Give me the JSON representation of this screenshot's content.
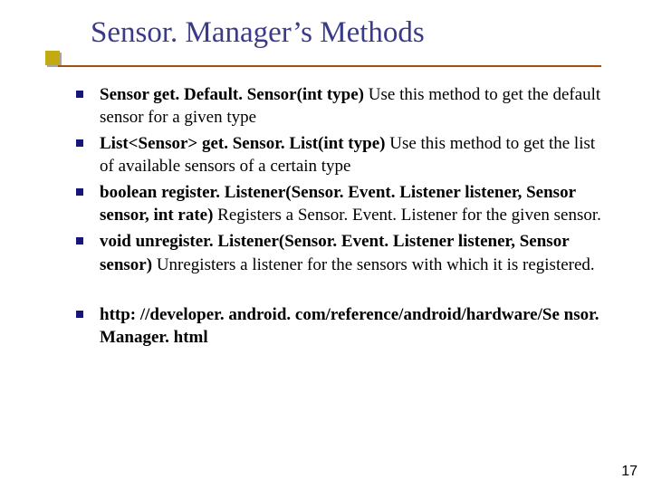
{
  "title": "Sensor. Manager’s Methods",
  "bullets_group1": [
    {
      "bold": "Sensor get. Default. Sensor(int type)",
      "rest": "  Use this method to get the default sensor for a given type"
    },
    {
      "bold": "List<Sensor> get. Sensor. List(int type)",
      "rest": "  Use this method to get the list of available sensors of a certain type"
    },
    {
      "bold": "boolean register. Listener(Sensor. Event. Listener listener, Sensor sensor, int rate)",
      "rest": "  Registers a Sensor. Event. Listener for the given sensor."
    },
    {
      "bold": "void unregister. Listener(Sensor. Event. Listener listener, Sensor sensor)",
      "rest": "  Unregisters a listener for the sensors with which it is registered."
    }
  ],
  "bullets_group2": [
    {
      "bold": "http: //developer. android. com/reference/android/hardware/Se nsor. Manager. html",
      "rest": ""
    }
  ],
  "page_number": "17"
}
